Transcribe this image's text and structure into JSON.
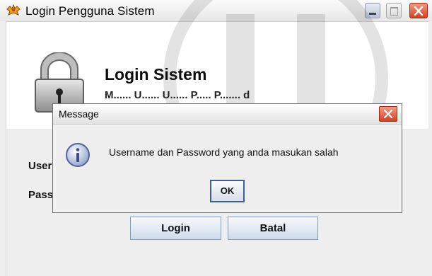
{
  "window": {
    "title": "Login Pengguna Sistem",
    "icons": {
      "app": "app-icon",
      "minimize": "minimize-icon",
      "maximize": "maximize-icon",
      "close": "close-icon"
    }
  },
  "header": {
    "title": "Login Sistem",
    "subtitle": "M...... U...... U...... P..... P....... d"
  },
  "form": {
    "username_label": "Username",
    "password_label": "Password",
    "login_button": "Login",
    "cancel_button": "Batal"
  },
  "dialog": {
    "title": "Message",
    "message": "Username dan Password yang anda masukan salah",
    "ok_button": "OK",
    "icon": "info-icon"
  },
  "colors": {
    "dialog_title_bg": "#e1e1e1",
    "close_button": "#d34125",
    "accent": "#7f9db9"
  }
}
